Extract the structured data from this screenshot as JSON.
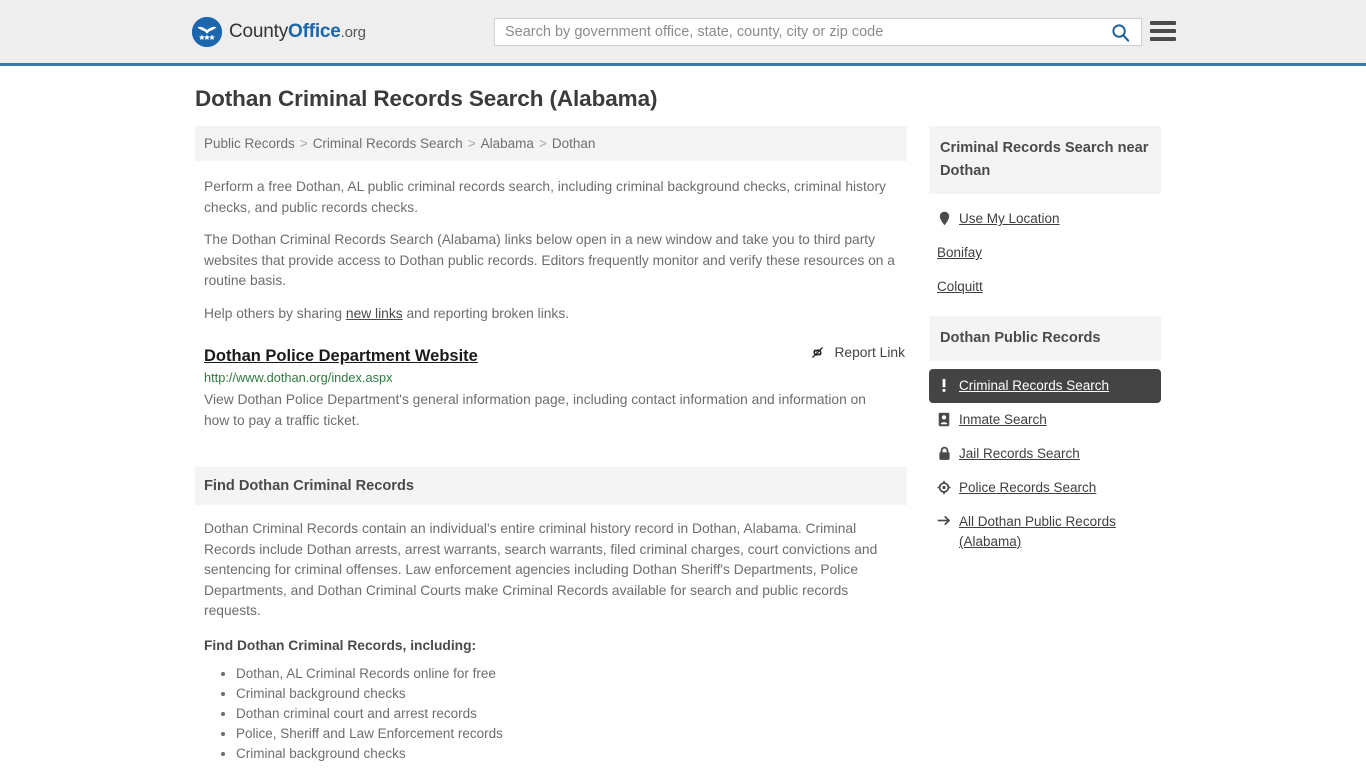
{
  "header": {
    "logo": {
      "prefix": "County",
      "bold": "Office",
      "suffix": ".org",
      "icon": "eagle-shield-logo"
    },
    "search": {
      "placeholder": "Search by government office, state, county, city or zip code",
      "value": "",
      "icon": "search-icon"
    },
    "menu_icon": "hamburger-menu-icon"
  },
  "page": {
    "title": "Dothan Criminal Records Search (Alabama)"
  },
  "breadcrumb": {
    "items": [
      {
        "label": "Public Records"
      },
      {
        "label": "Criminal Records Search"
      },
      {
        "label": "Alabama"
      },
      {
        "label": "Dothan"
      }
    ],
    "separator": ">"
  },
  "intro": {
    "paragraph_1": "Perform a free Dothan, AL public criminal records search, including criminal background checks, criminal history checks, and public records checks.",
    "paragraph_2": "The Dothan Criminal Records Search (Alabama) links below open in a new window and take you to third party websites that provide access to Dothan public records. Editors frequently monitor and verify these resources on a routine basis.",
    "paragraph_3_pre": "Help others by sharing ",
    "paragraph_3_link": "new links",
    "paragraph_3_post": " and reporting broken links."
  },
  "result": {
    "title": "Dothan Police Department Website",
    "url": "http://www.dothan.org/index.aspx",
    "description": "View Dothan Police Department's general information page, including contact information and information on how to pay a traffic ticket.",
    "report_label": "Report Link",
    "report_icon": "broken-link-icon"
  },
  "section": {
    "heading": "Find Dothan Criminal Records",
    "paragraph": "Dothan Criminal Records contain an individual's entire criminal history record in Dothan, Alabama. Criminal Records include Dothan arrests, arrest warrants, search warrants, filed criminal charges, court convictions and sentencing for criminal offenses. Law enforcement agencies including Dothan Sheriff's Departments, Police Departments, and Dothan Criminal Courts make Criminal Records available for search and public records requests.",
    "list_heading": "Find Dothan Criminal Records, including:",
    "list_items": [
      "Dothan, AL Criminal Records online for free",
      "Criminal background checks",
      "Dothan criminal court and arrest records",
      "Police, Sheriff and Law Enforcement records",
      "Criminal background checks"
    ]
  },
  "sidebar": {
    "nearby": {
      "heading": "Criminal Records Search near Dothan",
      "items": [
        {
          "label": "Use My Location",
          "icon": "map-pin-icon",
          "has_icon": true
        },
        {
          "label": "Bonifay",
          "icon": "",
          "has_icon": false
        },
        {
          "label": "Colquitt",
          "icon": "",
          "has_icon": false
        }
      ]
    },
    "public_records": {
      "heading": "Dothan Public Records",
      "items": [
        {
          "label": "Criminal Records Search",
          "icon": "exclamation-icon",
          "active": true
        },
        {
          "label": "Inmate Search",
          "icon": "id-badge-icon",
          "active": false
        },
        {
          "label": "Jail Records Search",
          "icon": "padlock-icon",
          "active": false
        },
        {
          "label": "Police Records Search",
          "icon": "police-badge-icon",
          "active": false
        },
        {
          "label": "All Dothan Public Records (Alabama)",
          "icon": "arrow-right-icon",
          "active": false
        }
      ]
    }
  },
  "colors": {
    "brand_blue": "#1b66ad",
    "header_border": "#3d76a8",
    "header_bg": "#eeeeee",
    "panel_bg": "#f4f4f4",
    "active_bg": "#444444",
    "url_green": "#2f7a3f"
  }
}
